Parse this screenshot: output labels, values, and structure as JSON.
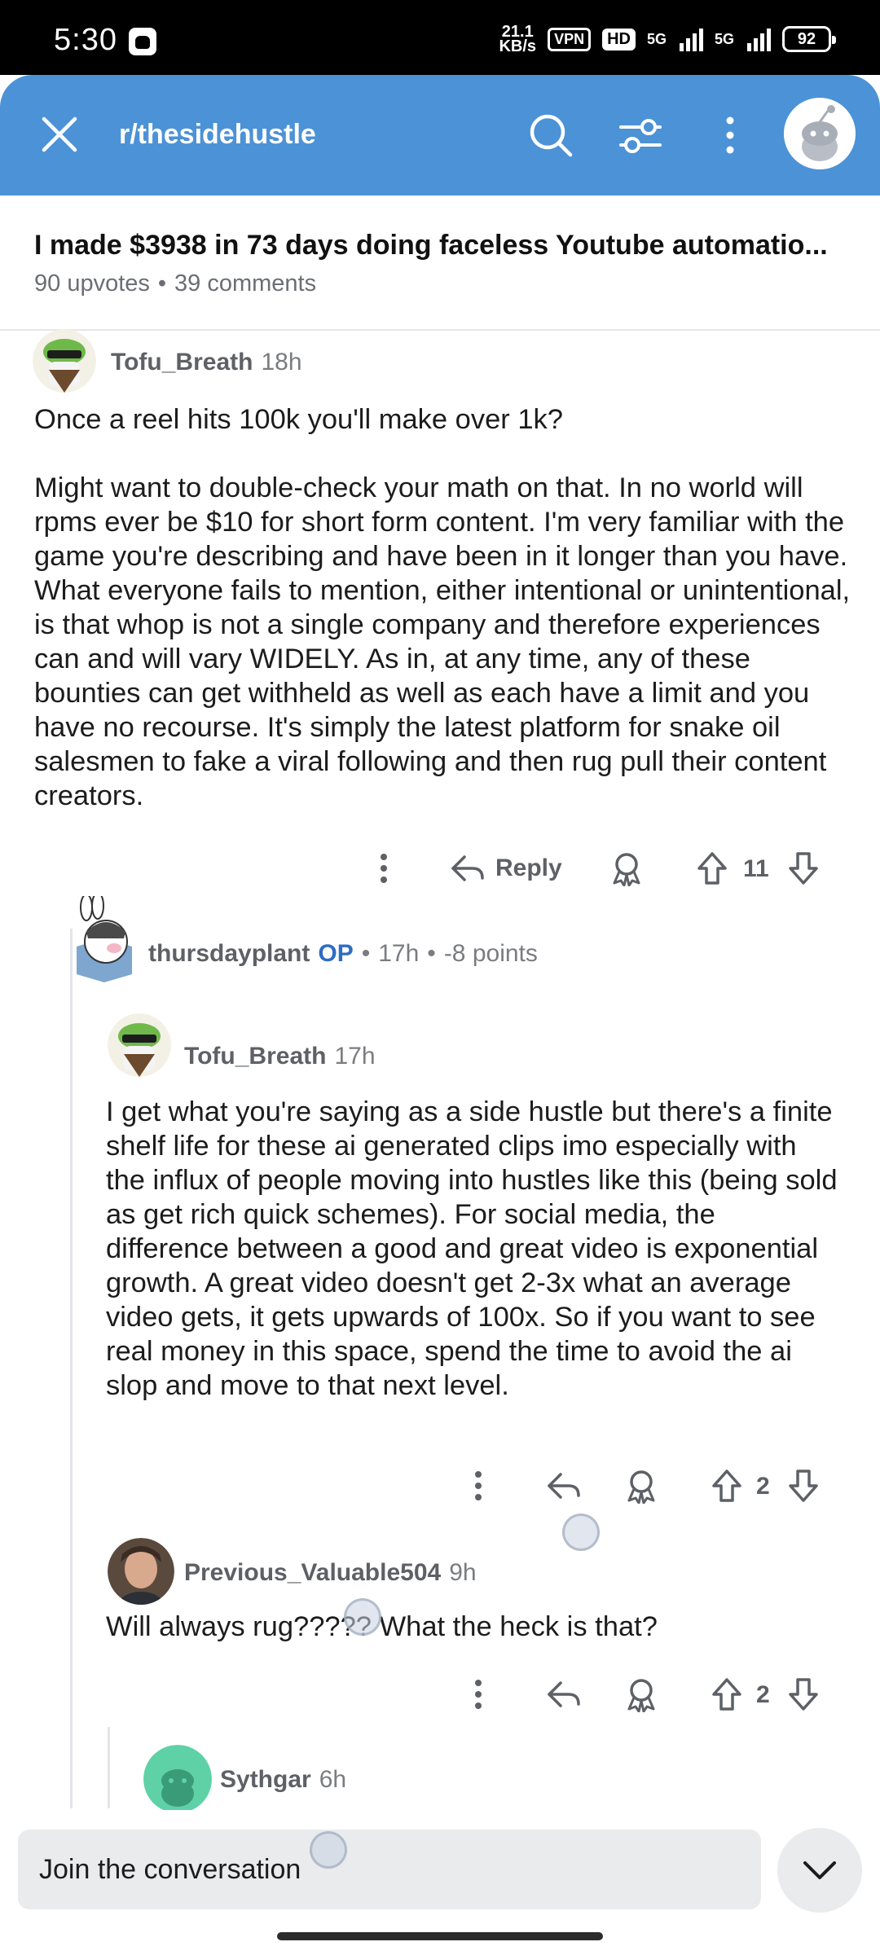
{
  "status_bar": {
    "time": "5:30",
    "net_speed_value": "21.1",
    "net_speed_unit": "KB/s",
    "vpn": "VPN",
    "hd": "HD",
    "network_1": "5G",
    "network_2": "5G",
    "battery": "92"
  },
  "header": {
    "subreddit": "r/thesidehustle",
    "icons": [
      "close-icon",
      "search-icon",
      "filter-icon",
      "more-vertical-icon",
      "snoo-avatar"
    ],
    "background": "#4c92d6"
  },
  "post": {
    "title": "I made $3938 in 73 days doing faceless Youtube automatio...",
    "upvotes": "90 upvotes",
    "separator": "•",
    "comments": "39 comments"
  },
  "comments": [
    {
      "author": "Tofu_Breath",
      "age": "18h",
      "paragraphs": [
        "Once a reel hits 100k you'll make over 1k?",
        "Might want to double-check your math on that. In no world will rpms ever be $10 for short form content. I'm very familiar with the game you're describing and have been in it longer than you have. What everyone fails to mention, either intentional or unintentional, is that whop is not a single company and therefore experiences can and will vary WIDELY. As in, at any time, any of these bounties can get withheld as well as each have a limit and you have no recourse. It's simply the latest platform for snake oil salesmen to fake a viral following and then rug pull their content creators."
      ],
      "reply_label": "Reply",
      "score": "11"
    },
    {
      "author": "thursdayplant",
      "op_tag": "OP",
      "separator": "•",
      "age": "17h",
      "points": "-8 points"
    },
    {
      "author": "Tofu_Breath",
      "age": "17h",
      "paragraphs": [
        "I get what you're saying as a side hustle but there's a finite shelf life for these ai generated clips imo especially with the influx of people moving into hustles like this (being sold as get rich quick schemes). For social media, the difference between a good and great video is exponential growth. A great video doesn't get 2-3x what an average video gets, it gets upwards of 100x. So if you want to see real money in this space, spend the time to avoid the ai slop and move to that next level."
      ],
      "score": "2"
    },
    {
      "author": "Previous_Valuable504",
      "age": "9h",
      "paragraphs": [
        "Will always rug????? What the heck is that?"
      ],
      "score": "2"
    },
    {
      "author": "Sythgar",
      "age": "6h"
    }
  ],
  "composer": {
    "placeholder": "Join the conversation"
  },
  "colors": {
    "accent": "#4c92d6",
    "op": "#2f6cc4",
    "muted": "#5d6166"
  }
}
